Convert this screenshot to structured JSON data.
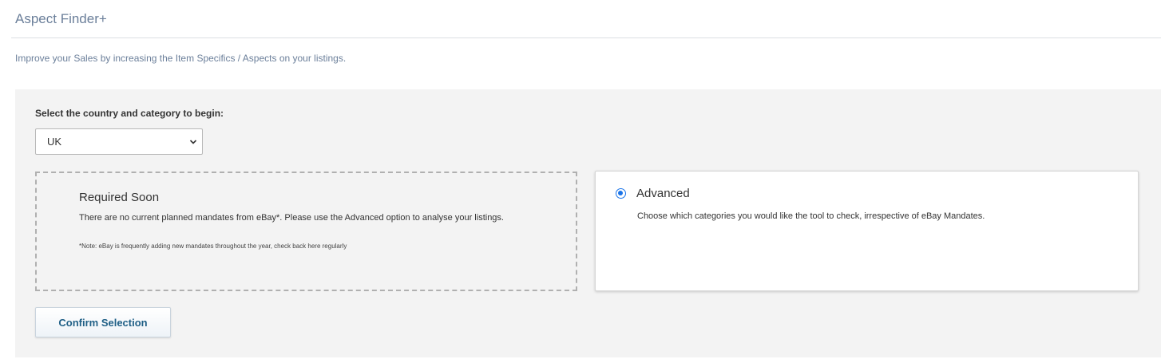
{
  "header": {
    "title": "Aspect Finder+",
    "subtitle": "Improve your Sales by increasing the Item Specifics / Aspects on your listings."
  },
  "selector": {
    "label": "Select the country and category to begin:",
    "selected_country": "UK"
  },
  "required_soon": {
    "title": "Required Soon",
    "text": "There are no current planned mandates from eBay*. Please use the Advanced option to analyse your listings.",
    "note": "*Note: eBay is frequently adding new mandates throughout the year, check back here regularly"
  },
  "advanced": {
    "title": "Advanced",
    "text": "Choose which categories you would like the tool to check, irrespective of eBay Mandates.",
    "selected": true
  },
  "actions": {
    "confirm_label": "Confirm Selection"
  },
  "colors": {
    "accent": "#1a73e8",
    "title_text": "#6b7f9a",
    "button_text": "#1f5f86",
    "panel_bg": "#f3f3f3"
  }
}
